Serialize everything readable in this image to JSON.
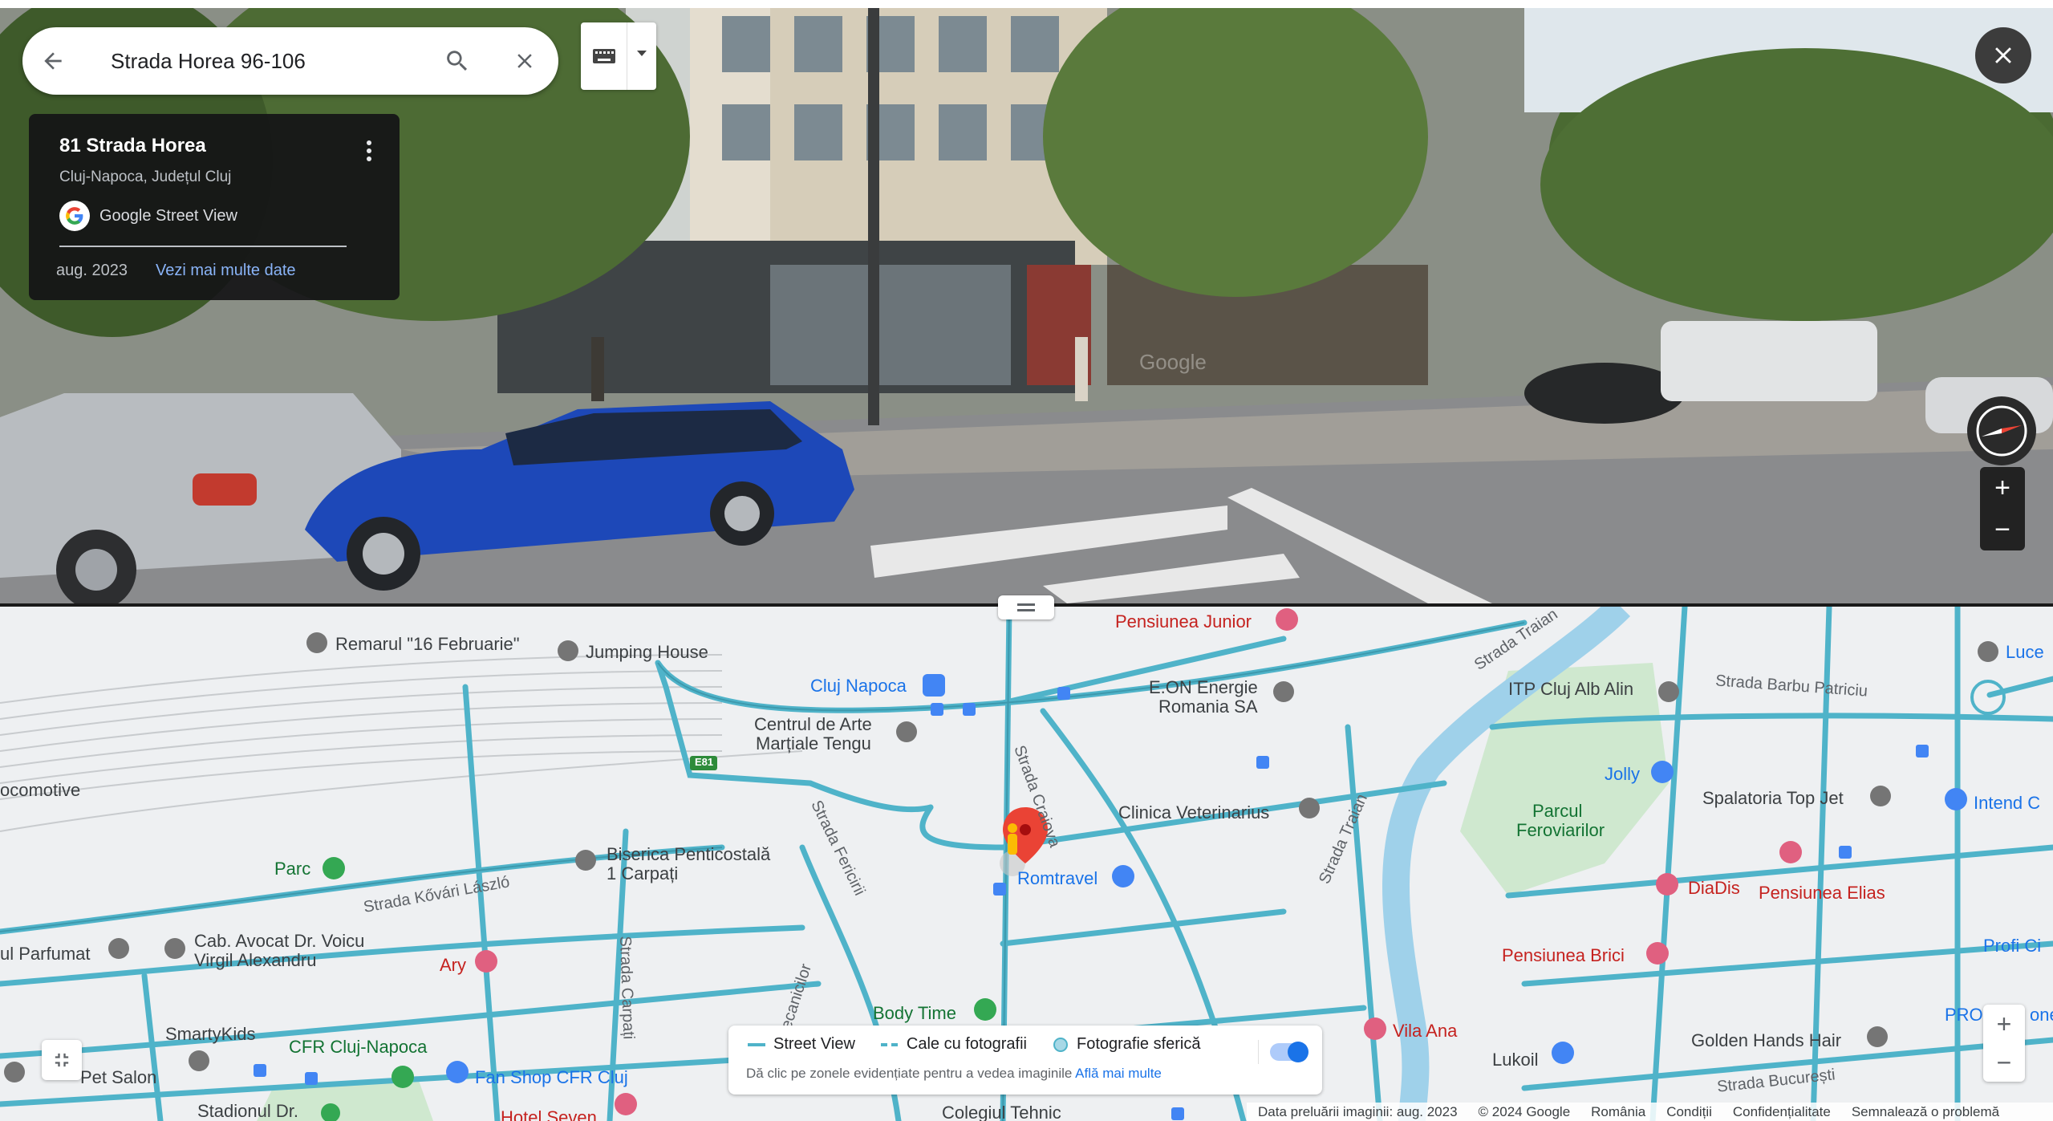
{
  "search": {
    "query": "Strada Horea 96-106"
  },
  "info_card": {
    "address": "81 Strada Horea",
    "city": "Cluj-Napoca, Județul Cluj",
    "source": "Google Street View",
    "date": "aug. 2023",
    "more_link": "Vezi mai multe date"
  },
  "pano": {
    "watermark": "Google"
  },
  "map_labels": {
    "remarul": "Remarul \"16 Februarie\"",
    "jumping": "Jumping House",
    "pensiunea_junior": "Pensiunea Junior",
    "cluj_napoca": "Cluj Napoca",
    "eon_1": "E.ON Energie",
    "eon_2": "Romania SA",
    "itp": "ITP Cluj Alb Alin",
    "barbu": "Strada Barbu Patriciu",
    "luce": "Luce",
    "traian_top": "Strada Traian",
    "centrul_1": "Centrul de Arte",
    "centrul_2": "Marțiale Tengu",
    "e81": "E81",
    "locomotive": "ocomotive",
    "jolly": "Jolly",
    "spalatoria": "Spalatoria Top Jet",
    "intend": "Intend C",
    "parcul_1": "Parcul",
    "parcul_2": "Feroviarilor",
    "clinica": "Clinica Veterinarius",
    "craiova": "Strada Craiova",
    "traian_mid": "Strada Traian",
    "fericirii": "Strada Fericirii",
    "parc": "Parc",
    "biserica_1": "Biserica Penticostală",
    "biserica_2": "1 Carpați",
    "kovari": "Strada Kővári László",
    "romtravel": "Romtravel",
    "diadis": "DiaDis",
    "pensiunea_elias": "Pensiunea Elias",
    "profi": "Profi Ci",
    "parfumat": "ul Parfumat",
    "cab_1": "Cab. Avocat Dr. Voicu",
    "cab_2": "Virgil Alexandru",
    "ary": "Ary",
    "carpati": "Strada Carpați",
    "mecanicilor": "Strada Mecanicilor",
    "pensiunea_brici": "Pensiunea Brici",
    "smartykids": "SmartyKids",
    "body_time": "Body Time",
    "vila_ana": "Vila Ana",
    "pro": "PRO",
    "one": "one",
    "pet_salon": "Pet Salon",
    "cfr": "CFR Cluj-Napoca",
    "fan_shop": "Fan Shop CFR Cluj",
    "lukoil": "Lukoil",
    "golden": "Golden Hands Hair",
    "bucuresti": "Strada București",
    "stadionul": "Stadionul Dr.",
    "hotel": "Hotel Seven",
    "colegiul": "Colegiul Tehnic"
  },
  "legend": {
    "street_view": "Street View",
    "photo_path": "Cale cu fotografii",
    "spherical": "Fotografie sferică",
    "hint": "Dă clic pe zonele evidențiate pentru a vedea imaginile",
    "learn_more": "Află mai multe",
    "toggle_on": true
  },
  "footer": {
    "capture_date": "Data preluării imaginii: aug. 2023",
    "copyright": "© 2024 Google",
    "country": "România",
    "terms": "Condiții",
    "privacy": "Confidențialitate",
    "report": "Semnalează o problemă"
  },
  "colors": {
    "road_sv": "#4fb3c9",
    "road_dark": "#2b7f92",
    "pink_poi": "#e06080",
    "green_poi": "#34a853",
    "blue_poi": "#4285f4",
    "pin_red": "#ea4335",
    "pegman_yellow": "#fbbc04"
  },
  "icons": [
    "back-arrow-icon",
    "search-icon",
    "close-icon",
    "keyboard-icon",
    "caret-down-icon",
    "more-vert-icon",
    "google-g-icon",
    "compass-icon",
    "plus-icon",
    "minus-icon",
    "collapse-icon",
    "pegman-icon",
    "location-pin-icon"
  ]
}
